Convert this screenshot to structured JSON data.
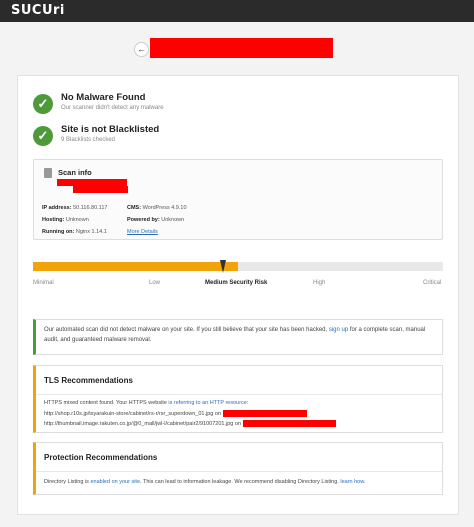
{
  "header": {
    "logo": "SUCUri"
  },
  "nav": {
    "back_icon": "arrow-left-icon"
  },
  "status": [
    {
      "title": "No Malware Found",
      "subtitle": "Our scanner didn't detect any malware"
    },
    {
      "title": "Site is not Blacklisted",
      "subtitle": "9 Blacklists checked"
    }
  ],
  "scan_info": {
    "title": "Scan info",
    "ip_label": "IP address:",
    "ip_value": "50.116.80.117",
    "hosting_label": "Hosting:",
    "hosting_value": "Unknown",
    "running_label": "Running on:",
    "running_value": "Nginx 1.14.1",
    "cms_label": "CMS:",
    "cms_value": "WordPress 4.9.10",
    "powered_label": "Powered by:",
    "powered_value": "Unknown",
    "more_details": "More Details"
  },
  "risk": {
    "level": 0.5,
    "labels": [
      "Minimal",
      "Low",
      "Medium Security Risk",
      "High",
      "Critical"
    ],
    "active_index": 2
  },
  "notice": {
    "text_before": "Our automated scan did not detect malware on your site. If you still believe that your site has been hacked, ",
    "link": "sign up",
    "text_after": " for a complete scan, manual audit, and guaranteed malware removal."
  },
  "tls": {
    "title": "TLS Recommendations",
    "line1_before": "HTTPS mixed content found. Your HTTPS website ",
    "line1_link": "is referring to an HTTP resource",
    "line1_after": ":",
    "line2": "http://shop.r10s.jp/tsyarakuin-store/cabinet/rs-r/rsr_superdown_01.jpg on",
    "line3": "http://thumbnail.image.rakuten.co.jp/@0_mall/jwl-l/cabinet/pair2/91007201.jpg on"
  },
  "protection": {
    "title": "Protection Recommendations",
    "text_before": "Directory Listing is ",
    "link1": "enabled on your site",
    "text_mid": ". This can lead to information leakage. We recommend disabling Directory Listing. ",
    "link2": "learn how."
  },
  "colors": {
    "accent": "#f0a30a",
    "success": "#4d9a3a",
    "redaction": "#ff0000",
    "topbar": "#2b2b2b",
    "link": "#2a6ebb"
  }
}
